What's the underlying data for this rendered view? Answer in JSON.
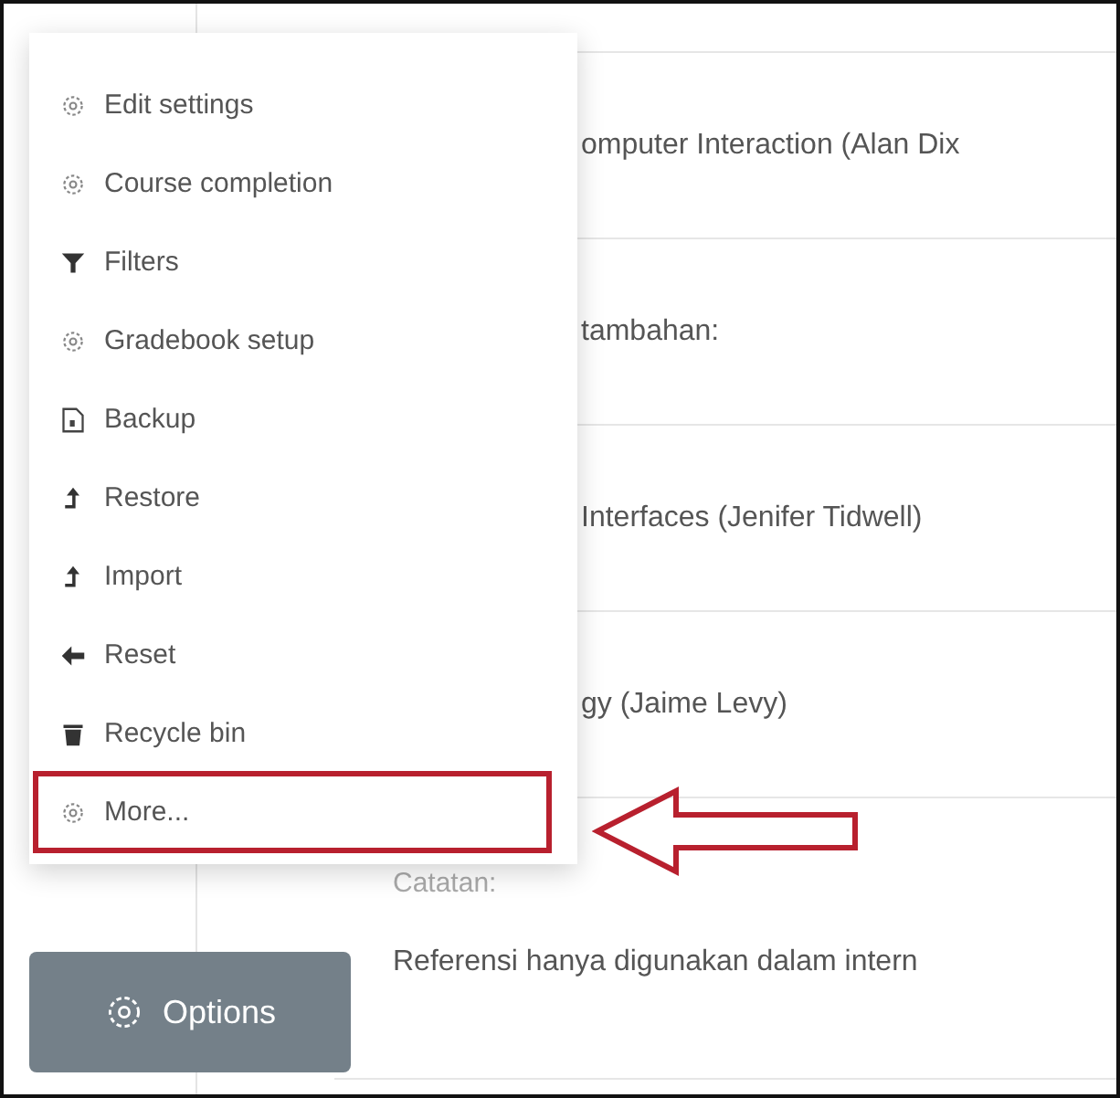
{
  "content_rows": [
    {
      "kind": "text",
      "text": "omputer Interaction (Alan Dix"
    },
    {
      "kind": "text",
      "text": "tambahan:"
    },
    {
      "kind": "text",
      "text": "Interfaces (Jenifer Tidwell)"
    },
    {
      "kind": "text",
      "text": "gy (Jaime Levy)"
    },
    {
      "kind": "note",
      "label": "Catatan:",
      "text": "Referensi hanya digunakan dalam intern"
    }
  ],
  "menu": {
    "items": [
      {
        "kind": "gear",
        "label": "Edit settings",
        "highlighted": false
      },
      {
        "kind": "gear",
        "label": "Course completion",
        "highlighted": false
      },
      {
        "kind": "filter",
        "label": "Filters",
        "highlighted": false
      },
      {
        "kind": "gear",
        "label": "Gradebook setup",
        "highlighted": false
      },
      {
        "kind": "file",
        "label": "Backup",
        "highlighted": false
      },
      {
        "kind": "upload",
        "label": "Restore",
        "highlighted": false
      },
      {
        "kind": "upload",
        "label": "Import",
        "highlighted": false
      },
      {
        "kind": "back",
        "label": "Reset",
        "highlighted": false
      },
      {
        "kind": "trash",
        "label": "Recycle bin",
        "highlighted": false
      },
      {
        "kind": "gear",
        "label": "More...",
        "highlighted": true
      }
    ]
  },
  "options_button": {
    "label": "Options"
  }
}
